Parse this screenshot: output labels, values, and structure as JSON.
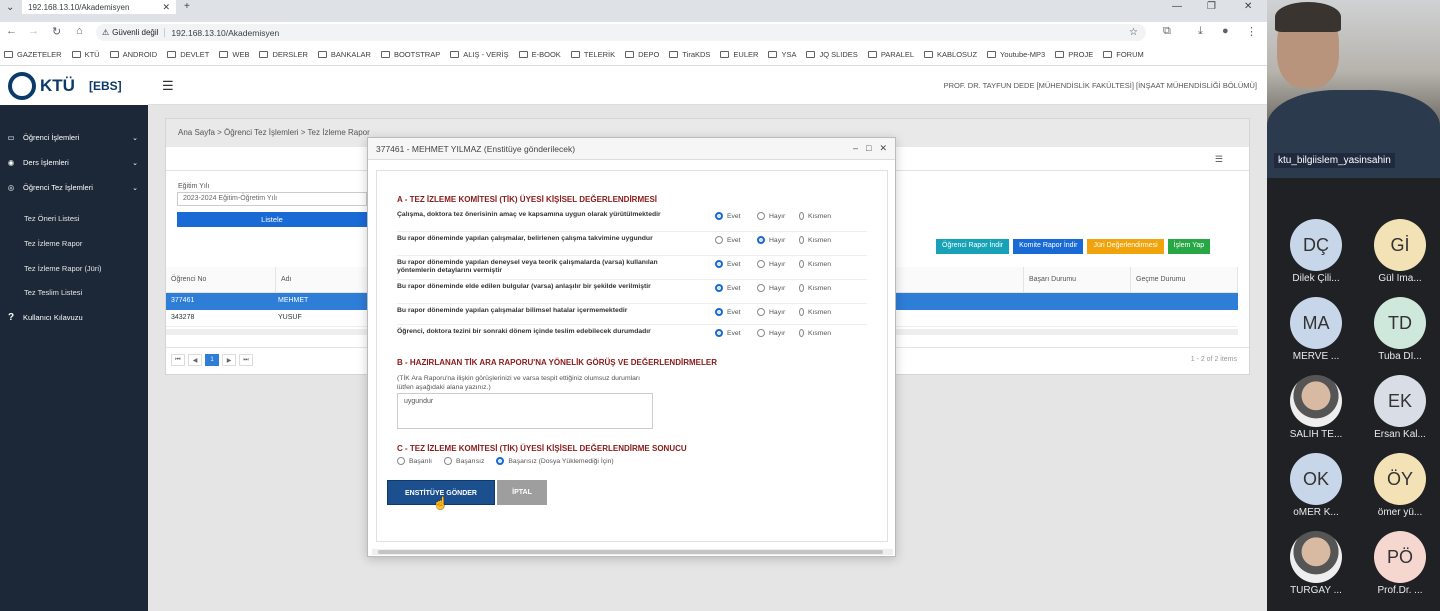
{
  "browser": {
    "tab_title": "192.168.13.10/Akademisyen",
    "security": "Güvenli değil",
    "url": "192.168.13.10/Akademisyen",
    "bookmarks": [
      "GAZETELER",
      "KTÜ",
      "ANDROID",
      "DEVLET",
      "WEB",
      "DERSLER",
      "BANKALAR",
      "BOOTSTRAP",
      "ALIŞ - VERİŞ",
      "E-BOOK",
      "TELERİK",
      "DEPO",
      "TiraKDS",
      "EULER",
      "YSA",
      "JQ SLIDES",
      "PARALEL",
      "KABLOSUZ",
      "Youtube-MP3",
      "PROJE",
      "FORUM"
    ]
  },
  "app": {
    "logo": "KTÜ",
    "ebs": "EBS",
    "user": "PROF. DR. TAYFUN DEDE  [MÜHENDİSLİK FAKÜLTESİ] [İNŞAAT MÜHENDİSLİĞİ BÖLÜMÜ]",
    "sidebar": {
      "main": [
        "Öğrenci İşlemleri",
        "Ders İşlemleri",
        "Öğrenci Tez İşlemleri"
      ],
      "sub": [
        "Tez Öneri Listesi",
        "Tez İzleme Rapor",
        "Tez İzleme Rapor (Jüri)",
        "Tez Teslim Listesi"
      ],
      "help": "Kullanıcı Kılavuzu"
    },
    "breadcrumb": "Ana Sayfa > Öğrenci Tez İşlemleri > Tez İzleme Rapor",
    "year_label": "Eğitim Yılı",
    "year_value": "2023-2024 Eğitim-Öğretim Yılı",
    "list_button": "Listele",
    "actions": [
      {
        "label": "Öğrenci Rapor İndir",
        "color": "#17a2b8"
      },
      {
        "label": "Komite Rapor İndir",
        "color": "#1a6ad6"
      },
      {
        "label": "Jüri Değerlendirmesi",
        "color": "#f0a30a"
      },
      {
        "label": "İşlem Yap",
        "color": "#28a745"
      }
    ],
    "grid": {
      "headers": [
        "Öğrenci No",
        "Adı",
        "Başarı Durumu",
        "Geçme Durumu"
      ],
      "rows": [
        [
          "377461",
          "MEHMET"
        ],
        [
          "343278",
          "YUSUF"
        ]
      ],
      "page": "1",
      "summary": "1 - 2 of 2 items"
    }
  },
  "modal": {
    "title": "377461 - MEHMET YILMAZ (Enstitüye gönderilecek)",
    "section_a": "A - TEZ İZLEME KOMİTESİ (TİK) ÜYESİ KİŞİSEL DEĞERLENDİRMESİ",
    "options": [
      "Evet",
      "Hayır",
      "Kısmen"
    ],
    "questions": [
      {
        "text": "Çalışma, doktora tez önerisinin amaç ve kapsamına uygun olarak yürütülmektedir",
        "selected": 0
      },
      {
        "text": "Bu rapor döneminde yapılan çalışmalar, belirlenen çalışma takvimine uygundur",
        "selected": 1
      },
      {
        "text": "Bu rapor döneminde yapılan deneysel veya teorik çalışmalarda (varsa) kullanılan yöntemlerin detaylarını vermiştir",
        "selected": 0
      },
      {
        "text": "Bu rapor döneminde elde edilen bulgular (varsa) anlaşılır bir şekilde verilmiştir",
        "selected": 0
      },
      {
        "text": "Bu rapor döneminde yapılan çalışmalar bilimsel hatalar içermemektedir",
        "selected": 0
      },
      {
        "text": "Öğrenci, doktora tezini bir sonraki dönem içinde teslim edebilecek durumdadır",
        "selected": 0
      }
    ],
    "section_b": "B - HAZIRLANAN TİK ARA RAPORU'NA YÖNELİK GÖRÜŞ VE DEĞERLENDİRMELER",
    "hint": "(TİK Ara Raporu'na ilişkin görüşlerinizi ve varsa tespit ettiğiniz olumsuz durumları lütfen aşağıdaki alana yazınız.)",
    "comment": "uygundur",
    "section_c": "C - TEZ İZLEME KOMİTESİ (TİK) ÜYESİ KİŞİSEL DEĞERLENDİRME SONUCU",
    "result_options": [
      "Başarılı",
      "Başarısız",
      "Başarısız (Dosya Yüklemediği İçin)"
    ],
    "result_selected": 2,
    "send": "ENSTİTÜYE GÖNDER",
    "cancel": "İPTAL"
  },
  "meeting": {
    "presenter": "ktu_bilgiislem_yasinsahin",
    "participants": [
      {
        "initials": "DÇ",
        "name": "Dilek Çili...",
        "color": "#c8d6ea"
      },
      {
        "initials": "Gİ",
        "name": "Gül İma...",
        "color": "#f2e2b6"
      },
      {
        "initials": "MA",
        "name": "MERVE ...",
        "color": "#c8d6ea"
      },
      {
        "initials": "TD",
        "name": "Tuba Dİ...",
        "color": "#cfe8dc"
      },
      {
        "initials": "",
        "name": "SALİH TE...",
        "color": "#ffffff"
      },
      {
        "initials": "EK",
        "name": "Ersan Kal...",
        "color": "#d9dde6"
      },
      {
        "initials": "OK",
        "name": "oMER K...",
        "color": "#c8d6ea"
      },
      {
        "initials": "ÖY",
        "name": "ömer yü...",
        "color": "#f2e2b6"
      },
      {
        "initials": "",
        "name": "TURGAY ...",
        "color": "#ffffff"
      },
      {
        "initials": "PÖ",
        "name": "Prof.Dr. ...",
        "color": "#f5d7cf"
      }
    ]
  }
}
